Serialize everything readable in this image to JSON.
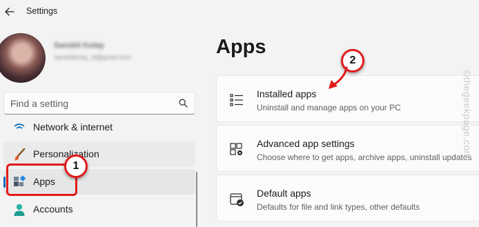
{
  "window": {
    "title": "Settings"
  },
  "profile": {
    "name": "Sanskit Kotay",
    "email": "sanskitkotay_dl@gmail.com"
  },
  "search": {
    "placeholder": "Find a setting"
  },
  "sidebar": {
    "items": [
      {
        "label": "Network & internet",
        "icon": "wifi-icon"
      },
      {
        "label": "Personalization",
        "icon": "brush-icon"
      },
      {
        "label": "Apps",
        "icon": "apps-icon",
        "selected": true
      },
      {
        "label": "Accounts",
        "icon": "person-icon"
      }
    ]
  },
  "main": {
    "title": "Apps",
    "cards": [
      {
        "title": "Installed apps",
        "subtitle": "Uninstall and manage apps on your PC",
        "icon": "list-icon"
      },
      {
        "title": "Advanced app settings",
        "subtitle": "Choose where to get apps, archive apps, uninstall updates",
        "icon": "app-gear-icon"
      },
      {
        "title": "Default apps",
        "subtitle": "Defaults for file and link types, other defaults",
        "icon": "default-apps-icon"
      }
    ]
  },
  "annotations": {
    "step1": "1",
    "step2": "2",
    "color": "#e21a1a"
  },
  "watermark": "©thegeekpage.com",
  "colors": {
    "accent": "#0067c0",
    "background": "#f3f3f3",
    "card": "#fbfbfb"
  }
}
